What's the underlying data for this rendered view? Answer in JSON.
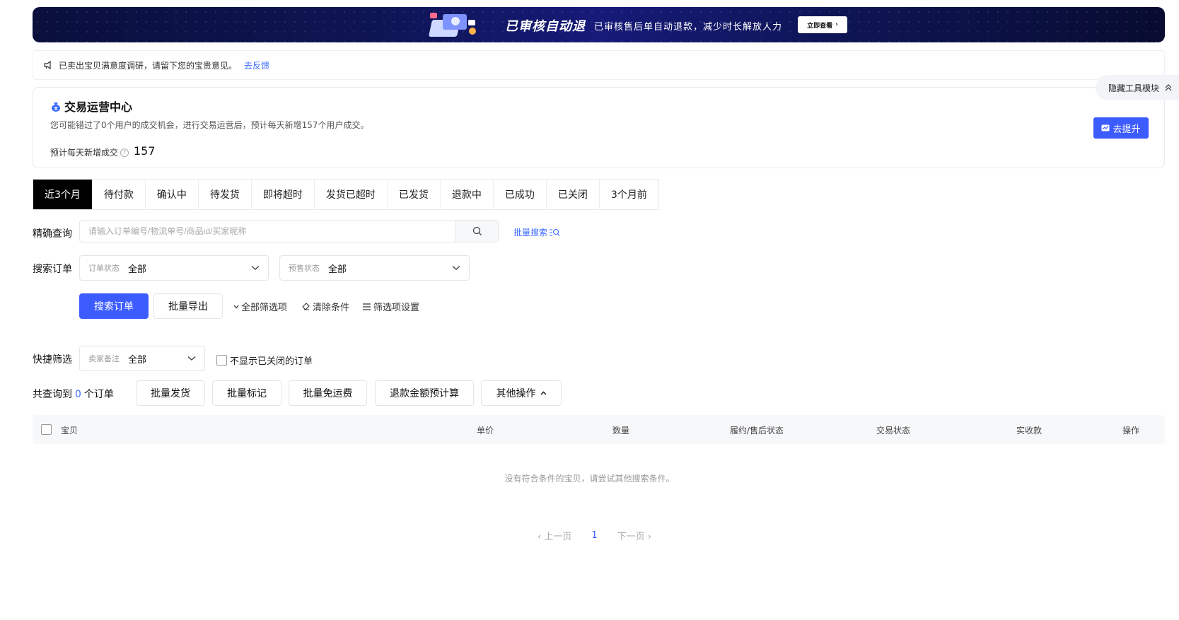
{
  "banner": {
    "title": "已审核自动退",
    "subtitle": "已审核售后单自动退款，减少时长解放人力",
    "button_label": "立即查看"
  },
  "notice": {
    "text": "已卖出宝贝满意度调研，请留下您的宝贵意见。",
    "link": "去反馈"
  },
  "trade_center": {
    "title": "交易运营中心",
    "description": "您可能错过了0个用户的成交机会，进行交易运营后，预计每天新增157个用户成交。",
    "metric_label": "预计每天新增成交",
    "metric_value": "157",
    "button_label": "去提升"
  },
  "hide_tools_label": "隐藏工具模块",
  "tabs": [
    {
      "label": "近3个月",
      "active": true
    },
    {
      "label": "待付款"
    },
    {
      "label": "确认中"
    },
    {
      "label": "待发货"
    },
    {
      "label": "即将超时"
    },
    {
      "label": "发货已超时"
    },
    {
      "label": "已发货"
    },
    {
      "label": "退款中"
    },
    {
      "label": "已成功"
    },
    {
      "label": "已关闭"
    },
    {
      "label": "3个月前"
    }
  ],
  "precise_search": {
    "label": "精确查询",
    "placeholder": "请输入订单编号/物流单号/商品id/买家昵称",
    "batch_search_label": "批量搜索"
  },
  "search_orders": {
    "label": "搜索订单",
    "order_status": {
      "key": "订单状态",
      "value": "全部"
    },
    "presale_status": {
      "key": "预售状态",
      "value": "全部"
    }
  },
  "actions": {
    "search_button": "搜索订单",
    "export_button": "批量导出",
    "all_filters": "全部筛选项",
    "clear_conditions": "清除条件",
    "filter_settings": "筛选项设置"
  },
  "quick_filter": {
    "label": "快捷筛选",
    "seller_note": {
      "key": "卖家备注",
      "value": "全部"
    },
    "hide_closed_label": "不显示已关闭的订单"
  },
  "result": {
    "prefix": "共查询到",
    "count": "0",
    "suffix": "个订单",
    "batch_ship": "批量发货",
    "batch_mark": "批量标记",
    "batch_free_shipping": "批量免运费",
    "refund_estimate": "退款金额预计算",
    "other_ops": "其他操作"
  },
  "table": {
    "columns": [
      "宝贝",
      "单价",
      "数量",
      "履约/售后状态",
      "交易状态",
      "实收款",
      "操作"
    ],
    "empty_text": "没有符合条件的宝贝，请尝试其他搜索条件。"
  },
  "pagination": {
    "prev": "上一页",
    "current": "1",
    "next": "下一页"
  },
  "colors": {
    "primary": "#3d5cff",
    "link": "#3d6cff",
    "active_tab": "#000000"
  }
}
